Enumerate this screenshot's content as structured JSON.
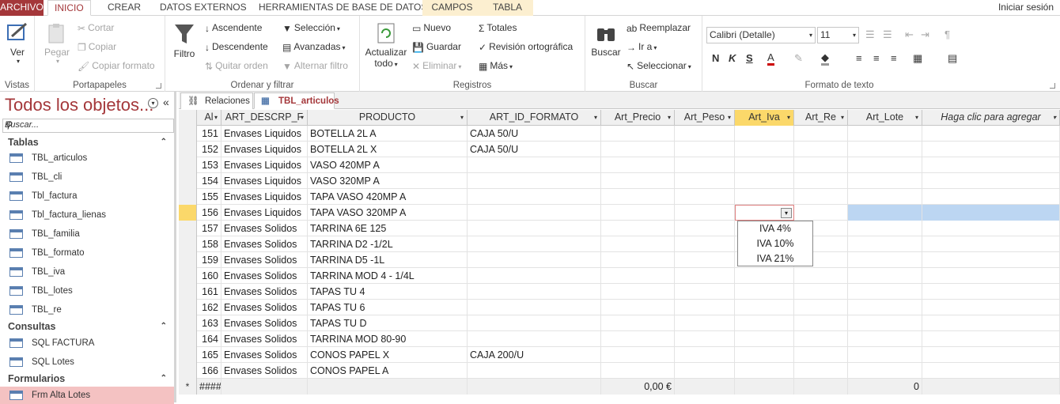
{
  "tabs": {
    "file": "ARCHIVO",
    "inicio": "INICIO",
    "crear": "CREAR",
    "datos": "DATOS EXTERNOS",
    "herr": "HERRAMIENTAS DE BASE DE DATOS",
    "campos": "CAMPOS",
    "tabla": "TABLA",
    "signin": "Iniciar sesión"
  },
  "ribbon": {
    "vistas": {
      "ver": "Ver",
      "label": "Vistas"
    },
    "portapapeles": {
      "pegar": "Pegar",
      "cortar": "Cortar",
      "copiar": "Copiar",
      "copiar_formato": "Copiar formato",
      "label": "Portapapeles"
    },
    "ordenar": {
      "filtro": "Filtro",
      "ascendente": "Ascendente",
      "descendente": "Descendente",
      "quitar_orden": "Quitar orden",
      "seleccion": "Selección",
      "avanzadas": "Avanzadas",
      "alternar_filtro": "Alternar filtro",
      "label": "Ordenar y filtrar"
    },
    "registros": {
      "actualizar1": "Actualizar",
      "actualizar2": "todo",
      "nuevo": "Nuevo",
      "guardar": "Guardar",
      "eliminar": "Eliminar",
      "totales": "Totales",
      "revision": "Revisión ortográfica",
      "mas": "Más",
      "label": "Registros"
    },
    "buscar": {
      "buscar": "Buscar",
      "reemplazar": "Reemplazar",
      "ira": "Ir a",
      "seleccionar": "Seleccionar",
      "label": "Buscar"
    },
    "formato": {
      "font": "Calibri (Detalle)",
      "size": "11",
      "label": "Formato de texto"
    }
  },
  "nav": {
    "title": "Todos los objetos...",
    "search_placeholder": "Buscar...",
    "tablas_header": "Tablas",
    "tablas": [
      "TBL_articulos",
      "TBL_cli",
      "Tbl_factura",
      "Tbl_factura_lienas",
      "TBL_familia",
      "TBL_formato",
      "TBL_iva",
      "TBL_lotes",
      "TBL_re"
    ],
    "consultas_header": "Consultas",
    "consultas": [
      "SQL FACTURA",
      "SQL Lotes"
    ],
    "formularios_header": "Formularios",
    "formularios": [
      "Frm Alta Lotes"
    ]
  },
  "doctabs": {
    "relaciones": "Relaciones",
    "articulos": "TBL_articulos"
  },
  "columns": [
    "Al",
    "ART_DESCRP_F",
    "PRODUCTO",
    "ART_ID_FORMATO",
    "Art_Precio",
    "Art_Peso",
    "Art_Iva",
    "Art_Re",
    "Art_Lote",
    "Haga clic para agregar"
  ],
  "rows": [
    [
      "151",
      "Envases Liquidos",
      "BOTELLA 2L A",
      "CAJA 50/U"
    ],
    [
      "152",
      "Envases Liquidos",
      "BOTELLA 2L X",
      "CAJA 50/U"
    ],
    [
      "153",
      "Envases Liquidos",
      "VASO 420MP A",
      ""
    ],
    [
      "154",
      "Envases Liquidos",
      "VASO 320MP A",
      ""
    ],
    [
      "155",
      "Envases Liquidos",
      "TAPA VASO 420MP A",
      ""
    ],
    [
      "156",
      "Envases Liquidos",
      "TAPA VASO 320MP A",
      ""
    ],
    [
      "157",
      "Envases Solidos",
      "TARRINA 6E 125",
      ""
    ],
    [
      "158",
      "Envases Solidos",
      "TARRINA D2 -1/2L",
      ""
    ],
    [
      "159",
      "Envases Solidos",
      "TARRINA D5 -1L",
      ""
    ],
    [
      "160",
      "Envases Solidos",
      "TARRINA MOD 4 - 1/4L",
      ""
    ],
    [
      "161",
      "Envases Solidos",
      "TAPAS TU 4",
      ""
    ],
    [
      "162",
      "Envases Solidos",
      "TAPAS TU 6",
      ""
    ],
    [
      "163",
      "Envases Solidos",
      "TAPAS TU D",
      ""
    ],
    [
      "164",
      "Envases Solidos",
      "TARRINA MOD 80-90",
      ""
    ],
    [
      "165",
      "Envases Solidos",
      "CONOS PAPEL X",
      "CAJA 200/U"
    ],
    [
      "166",
      "Envases Solidos",
      "CONOS PAPEL A",
      ""
    ]
  ],
  "newrow": {
    "marker": "*",
    "id": "####",
    "precio": "0,00 €",
    "lote": "0"
  },
  "dropdown": [
    "IVA 4%",
    "IVA 10%",
    "IVA 21%"
  ]
}
